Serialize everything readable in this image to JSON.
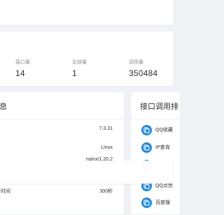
{
  "stats": [
    {
      "label": "接口量",
      "value": "14"
    },
    {
      "label": "友链量",
      "value": "1"
    },
    {
      "label": "调用量",
      "value": "350484"
    }
  ],
  "system_card": {
    "title": "息",
    "rows": [
      {
        "key": "",
        "value": "7.3.31"
      },
      {
        "key": "",
        "value": "Linux"
      },
      {
        "key": "",
        "value": "nginx/1.20.2"
      },
      {
        "key": "时间",
        "value": "300秒"
      }
    ]
  },
  "api_card": {
    "title": "接口调用排",
    "items": [
      {
        "name": "QQ收藏"
      },
      {
        "name": "IP查询"
      },
      {
        "name": ""
      },
      {
        "name": "QQ点赞"
      },
      {
        "name": "百度搜"
      }
    ]
  }
}
